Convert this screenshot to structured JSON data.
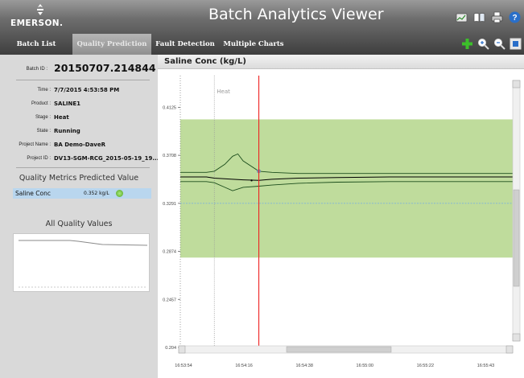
{
  "header": {
    "logo_text": "EMERSON.",
    "app_title": "Batch Analytics Viewer",
    "icons": [
      "trend-view-icon",
      "book-icon",
      "print-icon",
      "help-icon"
    ]
  },
  "tabs": [
    {
      "label": "Batch List",
      "active": false
    },
    {
      "label": "Quality Prediction",
      "active": true
    },
    {
      "label": "Fault Detection",
      "active": false
    },
    {
      "label": "Multiple Charts",
      "active": false
    }
  ],
  "toolbar_icons": [
    "add-icon",
    "zoom-in-icon",
    "zoom-out-icon",
    "fit-window-icon"
  ],
  "left_panel": {
    "batch_id_label": "Batch ID :",
    "batch_id": "20150707.214844",
    "properties": [
      {
        "label": "Time :",
        "value": "7/7/2015 4:53:58 PM"
      },
      {
        "label": "Product :",
        "value": "SALINE1"
      },
      {
        "label": "Stage :",
        "value": "Heat"
      },
      {
        "label": "State :",
        "value": "Running"
      },
      {
        "label": "Project Name :",
        "value": "BA Demo-DaveR"
      },
      {
        "label": "Project ID :",
        "value": "DV13-SGM-RCG_2015-05-19_19..."
      }
    ],
    "metrics_title": "Quality Metrics Predicted Value",
    "metrics": [
      {
        "name": "Saline Conc",
        "value": "0.352 kg/L",
        "status": "ok"
      }
    ],
    "all_quality_title": "All Quality Values"
  },
  "chart_panel": {
    "title": "Saline Conc (kg/L)",
    "stage_marker_label": "Heat"
  },
  "colors": {
    "band": "#bfdc9c",
    "current_time_line": "#ee2222",
    "target_line": "#7fb3d9",
    "selected_row": "#b9d6ee"
  },
  "chart_data": {
    "type": "line",
    "title": "Saline Conc (kg/L)",
    "x_ticks": [
      "16:53:54",
      "16:54:16",
      "16:54:38",
      "16:55:00",
      "16:55:22",
      "16:55:43"
    ],
    "y_ticks": [
      0.204,
      0.2457,
      0.2874,
      0.3291,
      0.3708,
      0.4125
    ],
    "ylim": [
      0.204,
      0.44
    ],
    "x_range_seconds": [
      0,
      127
    ],
    "grid": false,
    "acceptable_band": [
      0.282,
      0.402
    ],
    "target": 0.3291,
    "current_time_s": 30,
    "stage_start_s": 13,
    "series": [
      {
        "style": "prediction",
        "x": [
          0,
          10,
          13,
          20,
          24,
          30,
          35,
          45,
          60,
          80,
          100,
          127
        ],
        "y": [
          0.352,
          0.352,
          0.351,
          0.35,
          0.3495,
          0.349,
          0.35,
          0.351,
          0.3515,
          0.352,
          0.352,
          0.352
        ]
      },
      {
        "style": "upper-limit",
        "x": [
          0,
          10,
          13,
          17,
          20,
          22,
          24,
          30,
          35,
          45,
          60,
          80,
          100,
          127
        ],
        "y": [
          0.356,
          0.356,
          0.357,
          0.363,
          0.37,
          0.372,
          0.366,
          0.357,
          0.356,
          0.355,
          0.355,
          0.355,
          0.355,
          0.355
        ]
      },
      {
        "style": "lower-limit",
        "x": [
          0,
          10,
          13,
          17,
          20,
          24,
          30,
          35,
          45,
          60,
          80,
          100,
          127
        ],
        "y": [
          0.348,
          0.348,
          0.347,
          0.343,
          0.34,
          0.343,
          0.344,
          0.345,
          0.3465,
          0.3475,
          0.348,
          0.348,
          0.348
        ]
      }
    ],
    "current_point": {
      "x": 30,
      "y": 0.357
    }
  }
}
